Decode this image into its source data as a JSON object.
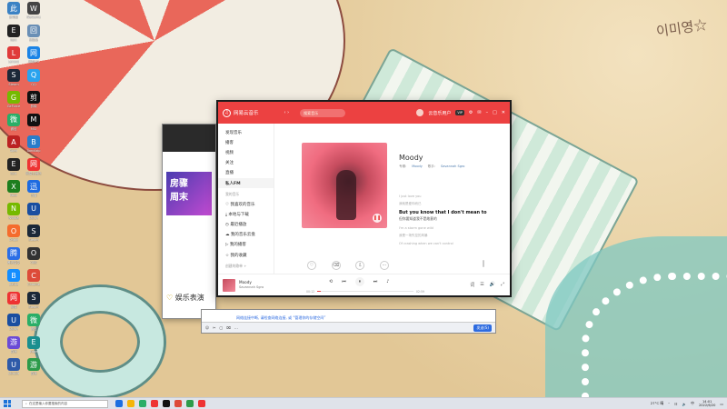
{
  "colors": {
    "brand_red": "#ec4141",
    "link_blue": "#507daf",
    "taskbar": "#dfe3ea"
  },
  "wallpaper": {
    "sand_text": "이미영☆"
  },
  "desktop_icons": [
    {
      "label": "此电脑",
      "color": "#3b82c4"
    },
    {
      "label": "WeGame",
      "color": "#444"
    },
    {
      "label": "Epic",
      "color": "#222"
    },
    {
      "label": "回收站",
      "color": "#6a8fb5"
    },
    {
      "label": "Lenovo",
      "color": "#e03a3a"
    },
    {
      "label": "网易UU",
      "color": "#1b84e6"
    },
    {
      "label": "Steam",
      "color": "#1b2838"
    },
    {
      "label": "QQ",
      "color": "#2aa3ee"
    },
    {
      "label": "GeForce",
      "color": "#76b900"
    },
    {
      "label": "剪映",
      "color": "#111"
    },
    {
      "label": "微信",
      "color": "#2aae67"
    },
    {
      "label": "MSI",
      "color": "#111"
    },
    {
      "label": "Apex",
      "color": "#b22"
    },
    {
      "label": "Bandizip",
      "color": "#2a7cc9"
    },
    {
      "label": "Epic",
      "color": "#222"
    },
    {
      "label": "网易云音乐",
      "color": "#e33"
    },
    {
      "label": "Xbox",
      "color": "#1e7e1e"
    },
    {
      "label": "迅雷",
      "color": "#1e6be0"
    },
    {
      "label": "Nvidia",
      "color": "#76b900"
    },
    {
      "label": "Uplay",
      "color": "#1a4ea0"
    },
    {
      "label": "Origin",
      "color": "#f56c2d"
    },
    {
      "label": "Steam",
      "color": "#1b2838"
    },
    {
      "label": "腾讯会议",
      "color": "#2b6ee6"
    },
    {
      "label": "OBS",
      "color": "#333"
    },
    {
      "label": "Battle",
      "color": "#148eff"
    },
    {
      "label": "Chrome",
      "color": "#dd4b39"
    },
    {
      "label": "网易",
      "color": "#e33"
    },
    {
      "label": "Steam",
      "color": "#1b2838"
    },
    {
      "label": "Uplay",
      "color": "#1a4ea0"
    },
    {
      "label": "微信",
      "color": "#2aae67"
    },
    {
      "label": "游戏",
      "color": "#6b4bd6"
    },
    {
      "label": "Edge",
      "color": "#1a8f8f"
    },
    {
      "label": "Ubisoft",
      "color": "#2e5aa8"
    },
    {
      "label": "游戏",
      "color": "#2d9b4a"
    }
  ],
  "back_window": {
    "promo_text": "房骤\n周末",
    "entertain_text": "娱乐表演"
  },
  "chat_window": {
    "banner": "网络连接中断, 请检查网络连接, 或 “管理你的存储空间”",
    "tools": [
      "☺",
      "✂",
      "▢",
      "⌧",
      "…"
    ],
    "send_label": "发送(S)"
  },
  "music_app": {
    "app_title": "网易云音乐",
    "nav": "‹  ›",
    "search_placeholder": "搜索音乐",
    "user_name": "云音乐用户",
    "vip": "VIP",
    "sidebar": {
      "items": [
        "发现音乐",
        "播客",
        "视频",
        "关注",
        "直播",
        "私人FM"
      ],
      "section_mine": "我的音乐",
      "mine_items": [
        "♡ 我喜欢的音乐",
        "⤓ 本地与下载",
        "◷ 最近播放",
        "☁ 我的音乐云盘",
        "▷ 我的播客",
        "☆ 我的收藏"
      ],
      "section_created": "创建的歌单 +"
    },
    "song": {
      "title": "Moody",
      "album_label": "专辑:",
      "album": "Moody",
      "artist_label": "歌手:",
      "artist": "Savannah Sgro"
    },
    "lyrics": [
      {
        "text": "I just love you",
        "type": "dim"
      },
      {
        "text": "我就是爱你而已",
        "type": "dim"
      },
      {
        "text": "But you know that I don't mean to",
        "type": "cur"
      },
      {
        "text": "但你要知道我不是故意的",
        "type": "cur-tr"
      },
      {
        "text": "I'm a storm gone wild",
        "type": "dim"
      },
      {
        "text": "我是一场失控的风暴",
        "type": "dim"
      },
      {
        "text": "Of crashing when we can't control",
        "type": "dim"
      }
    ],
    "actions": [
      "♡",
      "⌫",
      "⇩",
      "⋯"
    ],
    "player": {
      "title": "Moody",
      "artist": "Savannah Sgro",
      "elapsed": "00:12",
      "duration": "02:59",
      "progress": 0.04,
      "controls": [
        "⟲",
        "⏮",
        "⏸",
        "⏭",
        "♪"
      ],
      "right_controls": [
        "词",
        "☰",
        "🔊",
        "⤢"
      ]
    }
  },
  "taskbar": {
    "search_placeholder": "在这里输入你要搜索的内容",
    "apps": [
      "#1d6fe0",
      "#f5b50b",
      "#2aae67",
      "#e33",
      "#111",
      "#dd4b39",
      "#2d9b4a",
      "#e33"
    ],
    "weather": "27°C 晴",
    "lang": "中",
    "time": "14:01",
    "date": "2022/6/20"
  }
}
